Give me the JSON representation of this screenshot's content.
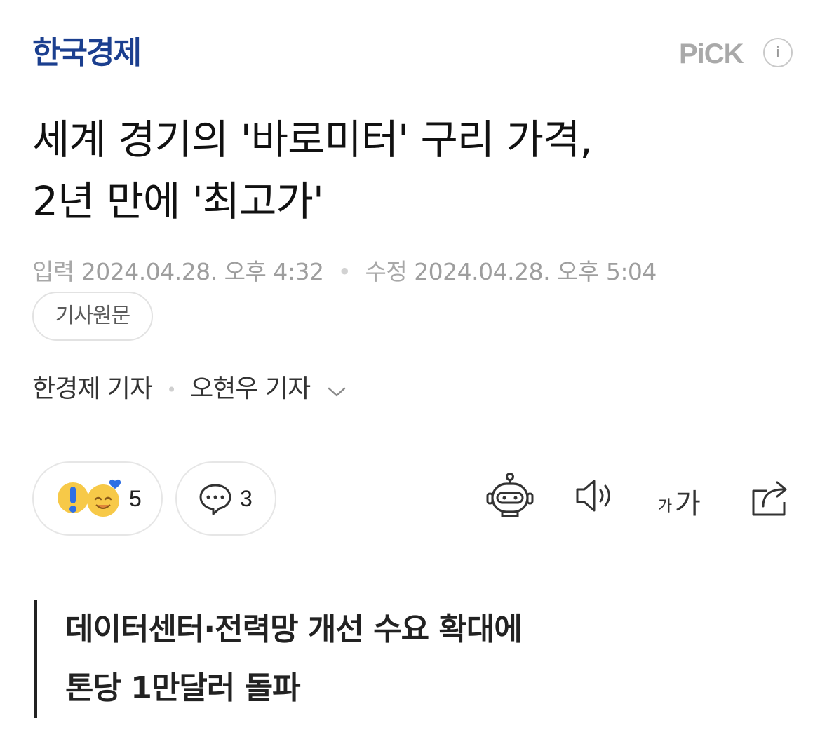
{
  "header": {
    "press_name": "한국경제",
    "pick_label": "PiCK",
    "info_label": "i"
  },
  "article": {
    "headline_line1": "세계 경기의 '바로미터' 구리 가격,",
    "headline_line2": "2년 만에 '최고가'",
    "input_label": "입력",
    "input_datetime": "2024.04.28. 오후 4:32",
    "modified_label": "수정",
    "modified_datetime": "2024.04.28. 오후 5:04",
    "original_link_label": "기사원문",
    "reporter1": "한경제 기자",
    "reporter2": "오현우 기자",
    "subheading_line1": "데이터센터·전력망 개선 수요 확대에",
    "subheading_line2": "톤당 1만달러 돌파"
  },
  "actions": {
    "reaction_count": "5",
    "comment_count": "3",
    "font_size_small": "가",
    "font_size_large": "가"
  },
  "icons": [
    "surprise-emoji-icon",
    "smile-heart-emoji-icon",
    "comment-bubble-icon",
    "robot-summary-icon",
    "speaker-icon",
    "font-size-icon",
    "share-icon",
    "chevron-down-icon"
  ],
  "colors": {
    "brand": "#1b3f8f",
    "emoji_yellow": "#f7c948",
    "emoji_blue": "#2f6fe4"
  }
}
